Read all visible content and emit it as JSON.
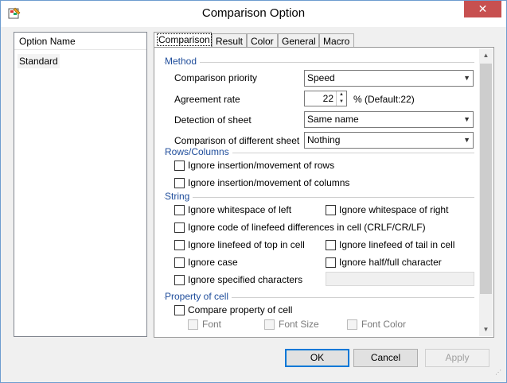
{
  "window": {
    "title": "Comparison Option",
    "close_glyph": "✕"
  },
  "option_list": {
    "header": "Option Name",
    "items": [
      "Standard"
    ]
  },
  "tabs": [
    {
      "label": "Comparison",
      "active": true
    },
    {
      "label": "Result"
    },
    {
      "label": "Color"
    },
    {
      "label": "General"
    },
    {
      "label": "Macro"
    }
  ],
  "method": {
    "title": "Method",
    "priority_label": "Comparison priority",
    "priority_value": "Speed",
    "agreement_label": "Agreement rate",
    "agreement_value": "22",
    "agreement_suffix": "% (Default:22)",
    "detection_label": "Detection of sheet",
    "detection_value": "Same name",
    "different_label": "Comparison of different sheet",
    "different_value": "Nothing"
  },
  "rows_columns": {
    "title": "Rows/Columns",
    "ignore_rows": "Ignore insertion/movement of rows",
    "ignore_columns": "Ignore insertion/movement of columns"
  },
  "string": {
    "title": "String",
    "ws_left": "Ignore whitespace of left",
    "ws_right": "Ignore whitespace of right",
    "linefeed_code": "Ignore code of linefeed differences in cell (CRLF/CR/LF)",
    "lf_top": "Ignore linefeed of top in cell",
    "lf_tail": "Ignore linefeed of tail in cell",
    "case": "Ignore case",
    "half_full": "Ignore half/full character",
    "specified": "Ignore specified characters"
  },
  "property": {
    "title": "Property of cell",
    "compare": "Compare property of cell",
    "font": "Font",
    "font_size": "Font Size",
    "font_color": "Font Color"
  },
  "buttons": {
    "ok": "OK",
    "cancel": "Cancel",
    "apply": "Apply"
  },
  "colors": {
    "section": "#1f4d9b",
    "close": "#c75050",
    "accent": "#0078d7"
  }
}
